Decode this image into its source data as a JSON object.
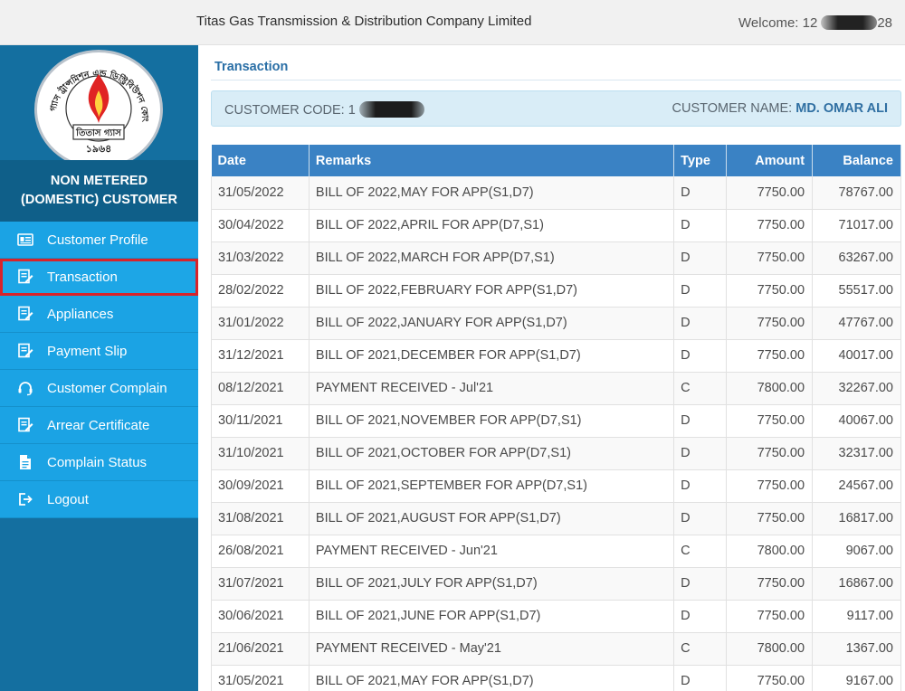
{
  "header": {
    "company": "Titas Gas Transmission & Distribution Company Limited",
    "welcome_label": "Welcome: 12",
    "welcome_tail": "28"
  },
  "logo": {
    "arc_text": "তিতাস গ্যাস ট্রান্সমিশন এন্ড ডিস্ট্রিবিউশন কোং লিঃ",
    "name": "তিতাস গ্যাস",
    "year": "১৯৬৪",
    "flame_color": "#e02424"
  },
  "sidebar": {
    "customer_type_line1": "NON METERED",
    "customer_type_line2": "(DOMESTIC) CUSTOMER",
    "items": [
      {
        "label": "Customer Profile",
        "icon": "profile-card-icon",
        "active": false
      },
      {
        "label": "Transaction",
        "icon": "document-edit-icon",
        "active": true
      },
      {
        "label": "Appliances",
        "icon": "document-edit-icon",
        "active": false
      },
      {
        "label": "Payment Slip",
        "icon": "document-edit-icon",
        "active": false
      },
      {
        "label": "Customer Complain",
        "icon": "headset-icon",
        "active": false
      },
      {
        "label": "Arrear Certificate",
        "icon": "document-edit-icon",
        "active": false
      },
      {
        "label": "Complain Status",
        "icon": "file-text-icon",
        "active": false
      },
      {
        "label": "Logout",
        "icon": "logout-icon",
        "active": false
      }
    ]
  },
  "main": {
    "title": "Transaction",
    "customer_code_label": "CUSTOMER CODE: ",
    "customer_code_visible": "1",
    "customer_name_label": "CUSTOMER NAME: ",
    "customer_name": "MD. OMAR ALI"
  },
  "table": {
    "headers": [
      "Date",
      "Remarks",
      "Type",
      "Amount",
      "Balance"
    ],
    "rows": [
      [
        "31/05/2022",
        "BILL OF 2022,MAY FOR APP(S1,D7)",
        "D",
        "7750.00",
        "78767.00"
      ],
      [
        "30/04/2022",
        "BILL OF 2022,APRIL FOR APP(D7,S1)",
        "D",
        "7750.00",
        "71017.00"
      ],
      [
        "31/03/2022",
        "BILL OF 2022,MARCH FOR APP(D7,S1)",
        "D",
        "7750.00",
        "63267.00"
      ],
      [
        "28/02/2022",
        "BILL OF 2022,FEBRUARY FOR APP(S1,D7)",
        "D",
        "7750.00",
        "55517.00"
      ],
      [
        "31/01/2022",
        "BILL OF 2022,JANUARY FOR APP(S1,D7)",
        "D",
        "7750.00",
        "47767.00"
      ],
      [
        "31/12/2021",
        "BILL OF 2021,DECEMBER FOR APP(S1,D7)",
        "D",
        "7750.00",
        "40017.00"
      ],
      [
        "08/12/2021",
        "PAYMENT RECEIVED - Jul'21",
        "C",
        "7800.00",
        "32267.00"
      ],
      [
        "30/11/2021",
        "BILL OF 2021,NOVEMBER FOR APP(D7,S1)",
        "D",
        "7750.00",
        "40067.00"
      ],
      [
        "31/10/2021",
        "BILL OF 2021,OCTOBER FOR APP(D7,S1)",
        "D",
        "7750.00",
        "32317.00"
      ],
      [
        "30/09/2021",
        "BILL OF 2021,SEPTEMBER FOR APP(D7,S1)",
        "D",
        "7750.00",
        "24567.00"
      ],
      [
        "31/08/2021",
        "BILL OF 2021,AUGUST FOR APP(S1,D7)",
        "D",
        "7750.00",
        "16817.00"
      ],
      [
        "26/08/2021",
        "PAYMENT RECEIVED - Jun'21",
        "C",
        "7800.00",
        "9067.00"
      ],
      [
        "31/07/2021",
        "BILL OF 2021,JULY FOR APP(S1,D7)",
        "D",
        "7750.00",
        "16867.00"
      ],
      [
        "30/06/2021",
        "BILL OF 2021,JUNE FOR APP(S1,D7)",
        "D",
        "7750.00",
        "9117.00"
      ],
      [
        "21/06/2021",
        "PAYMENT RECEIVED - May'21",
        "C",
        "7800.00",
        "1367.00"
      ],
      [
        "31/05/2021",
        "BILL OF 2021,MAY FOR APP(S1,D7)",
        "D",
        "7750.00",
        "9167.00"
      ]
    ]
  }
}
